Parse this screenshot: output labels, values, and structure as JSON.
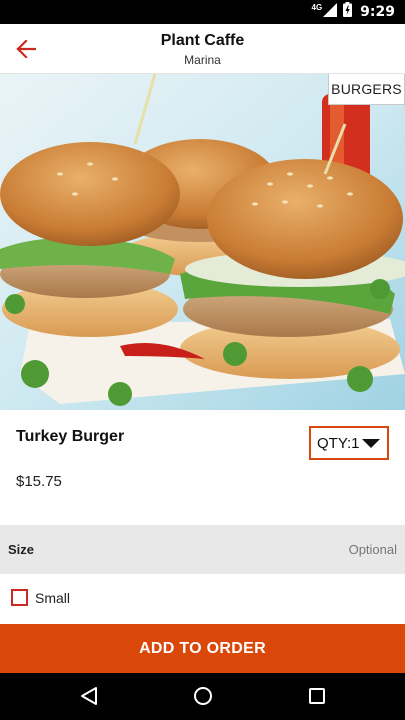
{
  "status_bar": {
    "network_label": "4G",
    "time": "9:29"
  },
  "app_bar": {
    "title": "Plant Caffe",
    "subtitle": "Marina"
  },
  "hero": {
    "category_badge": "BURGERS"
  },
  "product": {
    "name": "Turkey Burger",
    "price": "$15.75",
    "quantity_label": "QTY:1"
  },
  "size_section": {
    "title": "Size",
    "optional_label": "Optional",
    "options": [
      {
        "label": "Small",
        "checked": false
      }
    ]
  },
  "action": {
    "add_label": "ADD TO ORDER"
  },
  "colors": {
    "accent": "#d94709",
    "checkbox_border": "#cc2a20",
    "section_bg": "#e8e8e8"
  }
}
